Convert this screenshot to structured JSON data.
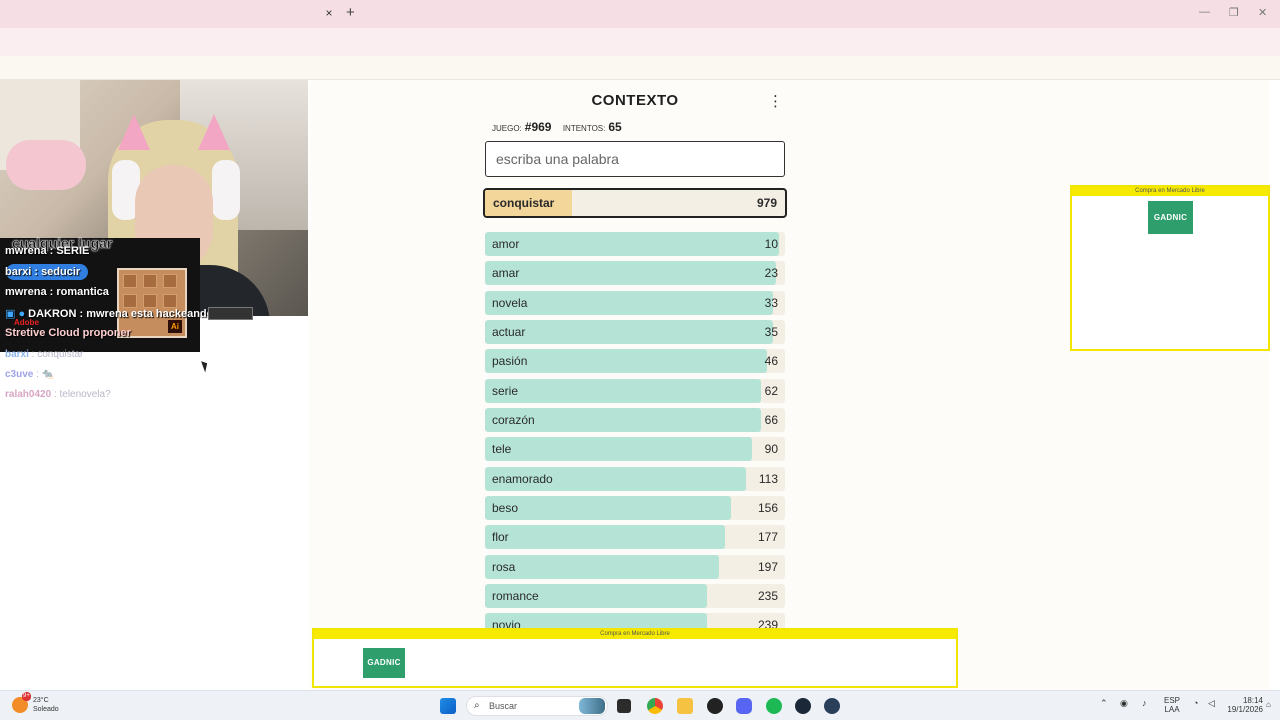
{
  "browser": {
    "tab_close": "×",
    "tab_new": "+",
    "window_controls": [
      "—",
      "❐",
      "✕"
    ],
    "toolbar_icons": [
      "install-icon",
      "star-icon",
      "translate-icon",
      "extensions-icon",
      "reading-list-icon",
      "profile-icon",
      "more-icon"
    ]
  },
  "game": {
    "title": "CONTEXTO",
    "menu": "⋮",
    "game_label": "JUEGO:",
    "game_number": "#969",
    "attempts_label": "INTENTOS:",
    "attempts": "65",
    "input_placeholder": "escriba una palabra",
    "current": {
      "word": "conquistar",
      "rank": "979",
      "fill_fraction": 0.29
    },
    "guesses": [
      {
        "word": "amor",
        "rank": "10",
        "fill_fraction": 0.98
      },
      {
        "word": "amar",
        "rank": "23",
        "fill_fraction": 0.97
      },
      {
        "word": "novela",
        "rank": "33",
        "fill_fraction": 0.96
      },
      {
        "word": "actuar",
        "rank": "35",
        "fill_fraction": 0.96
      },
      {
        "word": "pasión",
        "rank": "46",
        "fill_fraction": 0.94
      },
      {
        "word": "serie",
        "rank": "62",
        "fill_fraction": 0.92
      },
      {
        "word": "corazón",
        "rank": "66",
        "fill_fraction": 0.92
      },
      {
        "word": "tele",
        "rank": "90",
        "fill_fraction": 0.89
      },
      {
        "word": "enamorado",
        "rank": "113",
        "fill_fraction": 0.87
      },
      {
        "word": "beso",
        "rank": "156",
        "fill_fraction": 0.82
      },
      {
        "word": "flor",
        "rank": "177",
        "fill_fraction": 0.8
      },
      {
        "word": "rosa",
        "rank": "197",
        "fill_fraction": 0.78
      },
      {
        "word": "romance",
        "rank": "235",
        "fill_fraction": 0.74
      },
      {
        "word": "novio",
        "rank": "239",
        "fill_fraction": 0.74
      }
    ]
  },
  "ads": {
    "header": "Compra en Mercado Libre",
    "logo": "GADNIC"
  },
  "stream": {
    "overlay_title": "cualquier lugar",
    "chat": [
      {
        "text": "mwrena : SERIE"
      },
      {
        "text": "barxi : seducir"
      },
      {
        "text": "mwrena : romantica"
      },
      {
        "text": "DAKRON : mwrena esta hackeando"
      },
      {
        "text": "Stretive Cloud proponer"
      }
    ],
    "adobe_tag": "Adobe",
    "ai_badge": "Ai",
    "faded_chat": [
      {
        "user": "barxi",
        "msg": " : conquistar"
      },
      {
        "user": "c3uve",
        "msg": " : 🐀"
      },
      {
        "user": "ralah0420",
        "msg": " : telenovela?"
      }
    ]
  },
  "taskbar": {
    "weather_temp": "23°C",
    "weather_desc": "Soleado",
    "search_placeholder": "Buscar",
    "lang_top": "ESP",
    "lang_bottom": "LAA",
    "time": "18:14",
    "date": "19/1/2026",
    "notification_count": "9+"
  },
  "colors": {
    "close_fill": "#b5e4d6",
    "current_fill": "#f3d69a",
    "ad_yellow": "#f5ea00",
    "gadnic_green": "#2e9e6d"
  }
}
